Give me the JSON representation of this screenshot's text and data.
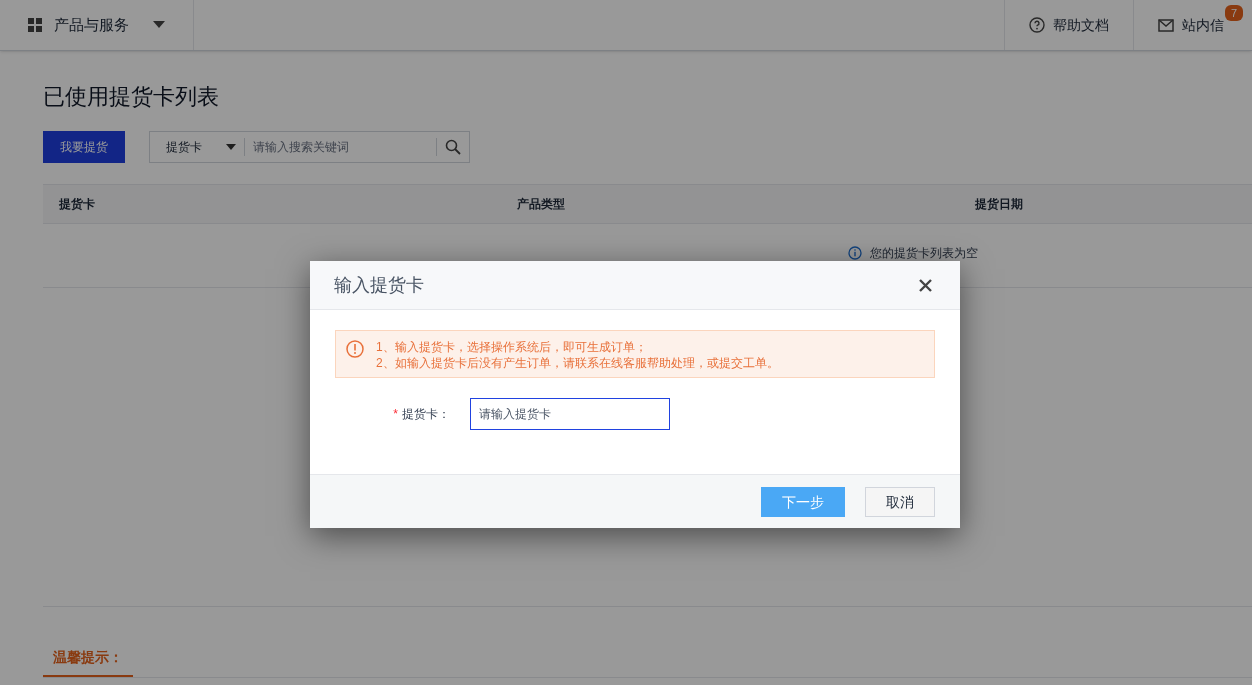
{
  "header": {
    "menu": "产品与服务",
    "help": "帮助文档",
    "messages": "站内信",
    "message_count": "7"
  },
  "page": {
    "title": "已使用提货卡列表",
    "action_button": "我要提货",
    "search": {
      "scope": "提货卡",
      "placeholder": "请输入搜索关键词"
    }
  },
  "table": {
    "columns": [
      "提货卡",
      "产品类型",
      "提货日期"
    ],
    "empty_text": "您的提货卡列表为空"
  },
  "tips_tab": {
    "label": "温馨提示：",
    "selected": true
  },
  "dialog": {
    "title": "输入提货卡",
    "notices": [
      "1、输入提货卡，选择操作系统后，即可生成订单；",
      "2、如输入提货卡后没有产生订单，请联系在线客服帮助处理，或提交工单。"
    ],
    "field": {
      "required_mark": "*",
      "label": "提货卡：",
      "placeholder": "请输入提货卡"
    },
    "buttons": [
      {
        "label": "下一步",
        "kind": "primary"
      },
      {
        "label": "取消",
        "kind": "default"
      }
    ]
  }
}
